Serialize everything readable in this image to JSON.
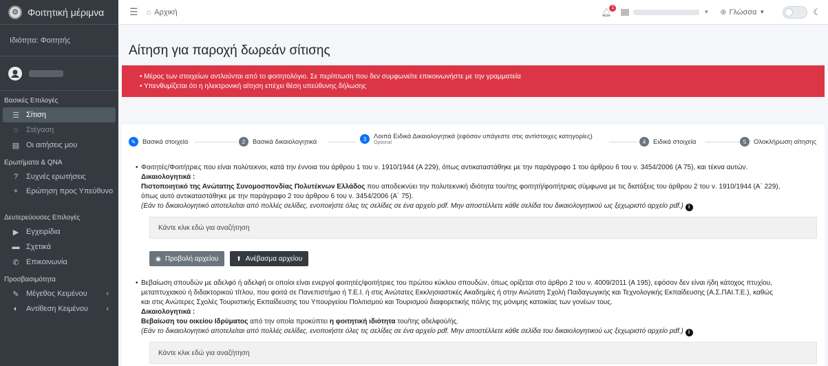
{
  "sidebar": {
    "brand": "Φοιτητική μέριμνα",
    "role": "Ιδιότητα: Φοιτητής",
    "sections": {
      "basic": "Βασικές Επιλογές",
      "faq": "Ερωτήματα & QNA",
      "secondary": "Δευτερεύουσες Επιλογές",
      "accessibility": "Προσβασιμότητα"
    },
    "items": {
      "food": "Σίτιση",
      "housing": "Στέγαση",
      "applications": "Οι αιτήσεις μου",
      "faq": "Συχνές ερωτήσεις",
      "ask": "Ερώτηση προς Υπεύθυνο",
      "manuals": "Εγχειρίδια",
      "about": "Σχετικά",
      "contact": "Επικοινωνία",
      "text_size": "Μέγεθος Κειμένου",
      "contrast": "Αντίθεση Κειμένου"
    }
  },
  "topbar": {
    "home": "Αρχική",
    "notif_count": "1",
    "language": "Γλώσσα"
  },
  "page": {
    "title": "Αίτηση για παροχή δωρεάν σίτισης",
    "alerts": [
      "Μέρος των στοιχείων αντλούνται από το φοιτητολόγιο. Σε περίπτωση που δεν συμφωνείτε επικοινωνήστε με την γραμματεία",
      "Υπενθυμίζεται ότι η ηλεκτρονική αίτηση επέχει θέση υπεύθυνης δήλωσης"
    ]
  },
  "stepper": {
    "steps": [
      {
        "num": "",
        "label": "Βασικά στοιχεία"
      },
      {
        "num": "2",
        "label": "Βασικά δικαιολογητικά"
      },
      {
        "num": "3",
        "label": "Λοιπά Ειδικά Δικαιολογητικά (εφόσον υπάγεστε στις αντίστοιχες κατηγορίες)",
        "sub": "Optional"
      },
      {
        "num": "4",
        "label": "Ειδικά στοιχεία"
      },
      {
        "num": "5",
        "label": "Ολοκλήρωση αίτησης"
      }
    ]
  },
  "documents": [
    {
      "text": "Φοιτητές/Φοιτήτριες που είναι πολύτεκνοι, κατά την έννοια του άρθρου 1 του ν. 1910/1944 (Α 229), όπως αντικαταστάθηκε με την παράγραφο 1 του άρθρου 6 του ν. 3454/2006 (Α 75), και τέκνα αυτών.",
      "heading": "Δικαιολογητικά :",
      "req_bold": "Πιστοποιητικό της Ανώτατης Συνομοσπονδίας Πολυτέκνων Ελλάδος",
      "req_rest": " που αποδεικνύει την πολυτεκνική ιδιότητα του/της φοιτητή/φοιτήτριας σύμφωνα με τις διατάξεις του άρθρου 2 του ν. 1910/1944 (Α΄ 229),",
      "req_line2": "όπως αυτό αντικαταστάθηκε με την παράγραφο 2 του άρθρου 6 του ν. 3454/2006 (Α΄ 75).",
      "note": "(Εάν το δικαιολογητικό αποτελείται από πολλές σελίδες, ενοποιήστε όλες τις σελίδες σε ένα αρχείο pdf. Μην αποστέλλετε κάθε σελίδα του δικαιολογητικού ως ξεχωριστό αρχείο pdf.)",
      "search": "Κάντε κλικ εδώ για αναζήτηση",
      "view_btn": "Προβολή αρχείου",
      "upload_btn": "Ανέβασμα αρχείου"
    },
    {
      "line1": "Βεβαίωση σπουδών με αδελφό ή αδελφή οι οποίοι είναι ενεργοί φοιτητές/φοιτήτριες του πρώτου κύκλου σπουδών, όπως ορίζεται στο άρθρο 2 του ν. 4009/2011 (Α 195), εφόσον δεν είναι ήδη κάτοχος πτυχίου,",
      "line2": "μεταπτυχιακού ή διδακτορικού τίτλου, που φοιτά σε Πανεπιστήμιο ή Τ.Ε.Ι. ή στις Ανώτατες Εκκλησιαστικές Ακαδημίες ή στην Ανώτατη Σχολή Παιδαγωγικής και Τεχνολογικής Εκπαίδευσης (Α.Σ.ΠΑΙ.Τ.Ε.), καθώς",
      "line3": "και στις Ανώτερες Σχολές Τουριστικής Εκπαίδευσης του Υπουργείου Πολιτισμού και Τουρισμού διαφορετικής πόλης της μόνιμης κατοικίας των γονέων τους.",
      "heading": "Δικαιολογητικά :",
      "req_bold": "Βεβαίωση του οικείου Ιδρύματος",
      "req_mid": " από την οποία προκύπτει ",
      "req_bold2": "η φοιτητική ιδιότητα",
      "req_end": " του/της αδελφού/ής.",
      "note": "(Εάν το δικαιολογητικό αποτελείται από πολλές σελίδες, ενοποιήστε όλες τις σελίδες σε ένα αρχείο pdf. Μην αποστέλλετε κάθε σελίδα του δικαιολογητικού ως ξεχωριστό αρχείο pdf.)",
      "search": "Κάντε κλικ εδώ για αναζήτηση"
    }
  ]
}
